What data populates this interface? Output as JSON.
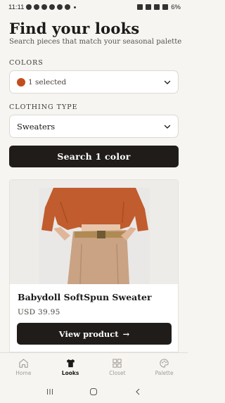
{
  "status_bar": {
    "time": "11:11",
    "battery": "6%"
  },
  "header": {
    "title": "Find your looks",
    "subtitle": "Search pieces that match your seasonal palette"
  },
  "filters": {
    "colors_label": "COLORS",
    "colors_value": "1 selected",
    "selected_color": "#c24e1c",
    "type_label": "CLOTHING TYPE",
    "type_value": "Sweaters"
  },
  "search_button": {
    "label": "Search 1 color"
  },
  "product": {
    "name": "Babydoll SoftSpun Sweater",
    "price": "USD 39.95",
    "view_label": "View product",
    "view_arrow": "→"
  },
  "bottom_nav": {
    "items": [
      {
        "label": "Home",
        "icon": "home-icon",
        "active": false
      },
      {
        "label": "Looks",
        "icon": "shirt-icon",
        "active": true
      },
      {
        "label": "Closet",
        "icon": "grid-icon",
        "active": false
      },
      {
        "label": "Palette",
        "icon": "palette-icon",
        "active": false
      }
    ]
  },
  "colors": {
    "accent_dark": "#1f1c1a",
    "swatch": "#c24e1c",
    "background": "#f6f5f2"
  }
}
